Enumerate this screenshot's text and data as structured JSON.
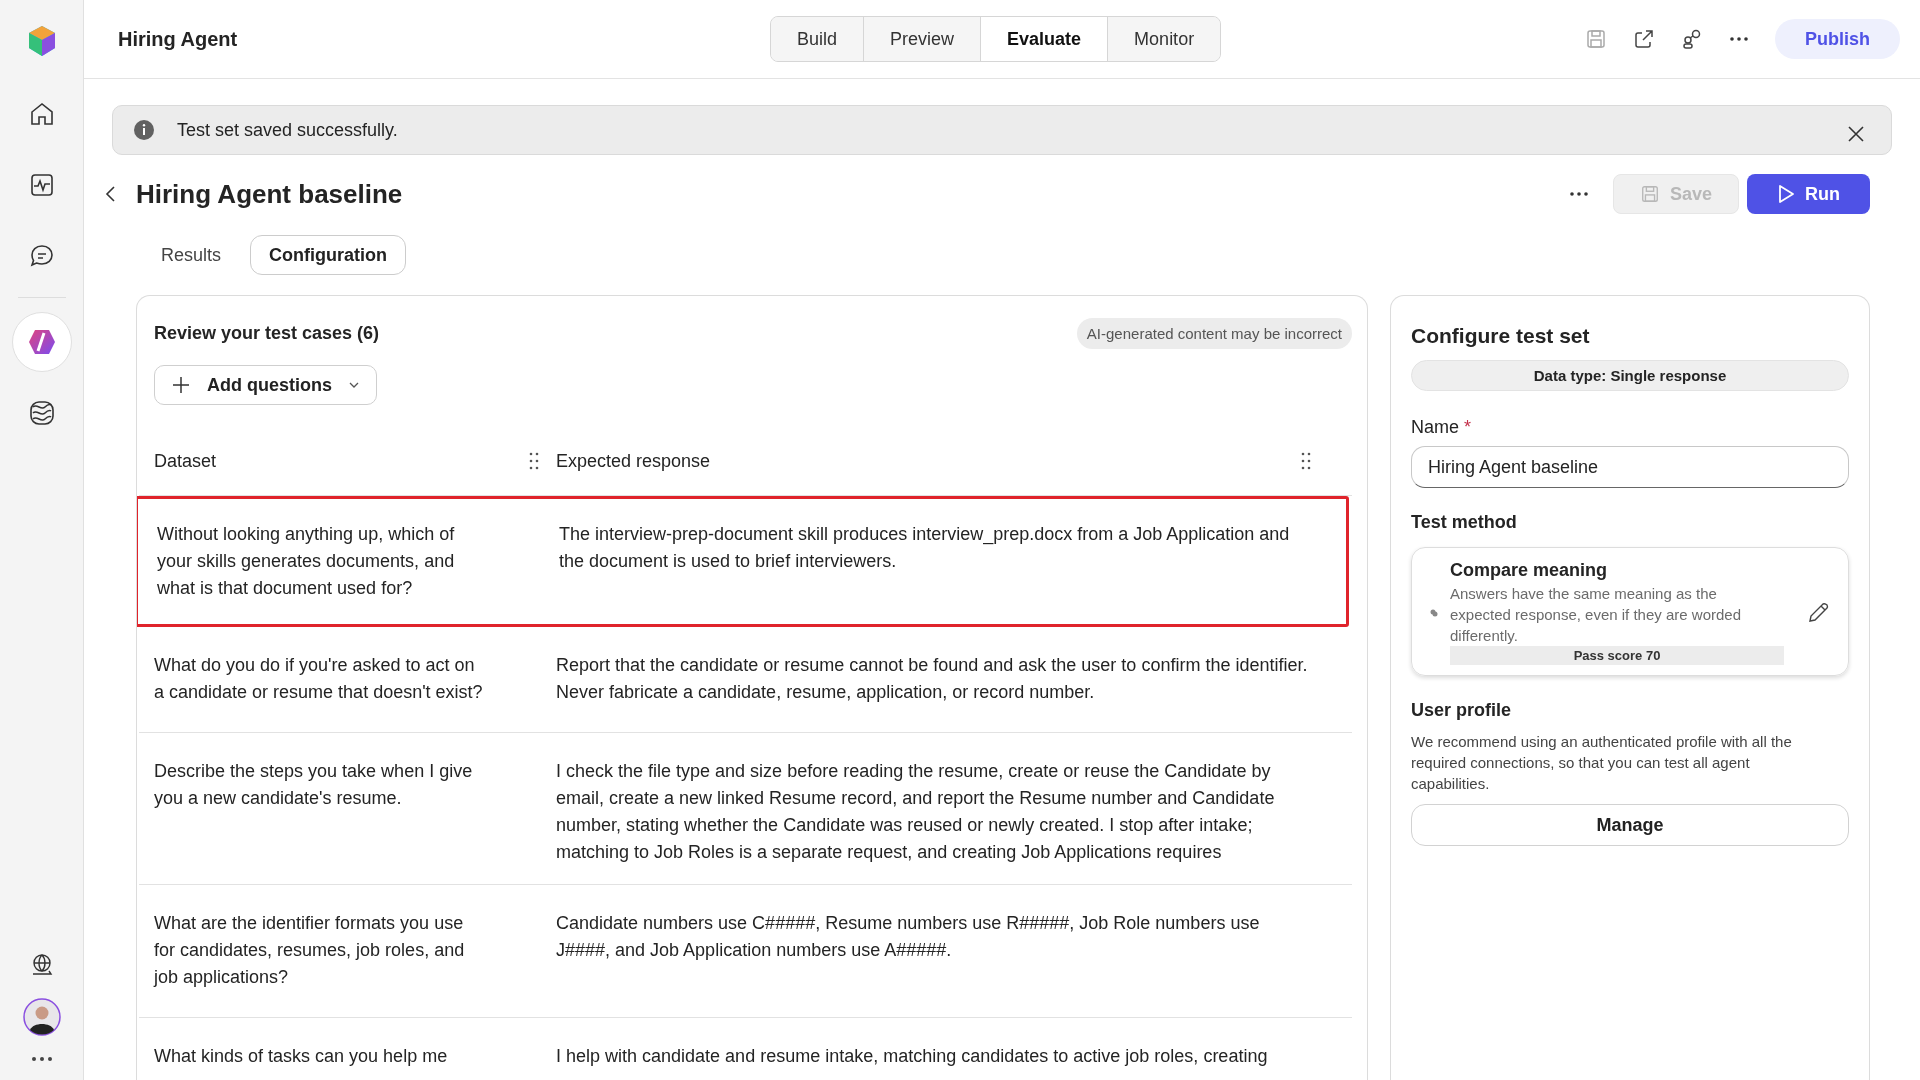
{
  "app": {
    "title": "Hiring Agent"
  },
  "sidebar": {
    "items": [
      {
        "kind": "home",
        "selected": false
      },
      {
        "kind": "activity",
        "selected": false
      },
      {
        "kind": "chat",
        "selected": false
      },
      {
        "kind": "agent",
        "selected": true
      },
      {
        "kind": "waves",
        "selected": false
      }
    ],
    "bottom": [
      {
        "kind": "globe"
      },
      {
        "kind": "avatar"
      },
      {
        "kind": "more"
      }
    ]
  },
  "nav_tabs": [
    {
      "label": "Build",
      "selected": false
    },
    {
      "label": "Preview",
      "selected": false
    },
    {
      "label": "Evaluate",
      "selected": true
    },
    {
      "label": "Monitor",
      "selected": false
    }
  ],
  "publish_button": "Publish",
  "banner": {
    "message": "Test set saved successfully."
  },
  "page": {
    "title": "Hiring Agent baseline",
    "save_button": {
      "label": "Save",
      "disabled": true
    },
    "run_button": "Run"
  },
  "sub_tabs": [
    {
      "label": "Results",
      "selected": false
    },
    {
      "label": "Configuration",
      "selected": true
    }
  ],
  "test_cases": {
    "title": "Review your test cases (6)",
    "ai_note": "AI-generated content may be incorrect",
    "add_button": "Add questions",
    "columns": [
      "Dataset",
      "Expected response"
    ],
    "rows": [
      {
        "question": "Without looking anything up, which of your skills generates documents, and what is that document used for?",
        "answer": "The interview-prep-document skill produces interview_prep.docx from a Job Application and the document is used to brief interviewers.",
        "highlighted": true
      },
      {
        "question": "What do you do if you're asked to act on a candidate or resume that doesn't exist?",
        "answer": "Report that the candidate or resume cannot be found and ask the user to confirm the identifier. Never fabricate a candidate, resume, application, or record number.",
        "highlighted": false
      },
      {
        "question": "Describe the steps you take when I give you a new candidate's resume.",
        "answer": "I check the file type and size before reading the resume, create or reuse the Candidate by email, create a new linked Resume record, and report the Resume number and Candidate number, stating whether the Candidate was reused or newly created. I stop after intake; matching to Job Roles is a separate request, and creating Job Applications requires",
        "highlighted": false
      },
      {
        "question": "What are the identifier formats you use for candidates, resumes, job roles, and job applications?",
        "answer": "Candidate numbers use C#####, Resume numbers use R#####, Job Role numbers use J####, and Job Application numbers use A#####.",
        "highlighted": false
      },
      {
        "question": "What kinds of tasks can you help me",
        "answer": "I help with candidate and resume intake, matching candidates to active job roles, creating",
        "highlighted": false
      }
    ]
  },
  "configure": {
    "title": "Configure test set",
    "data_type": "Data type: Single response",
    "name_label": "Name",
    "required_mark": "*",
    "name_value": "Hiring Agent baseline",
    "test_method_label": "Test method",
    "method": {
      "title": "Compare meaning",
      "description": "Answers have the same meaning as the expected response, even if they are worded differently.",
      "pass_score": "Pass score 70"
    },
    "user_profile_label": "User profile",
    "user_profile_text": "We recommend using an authenticated profile with all the required connections, so that you can test all agent capabilities.",
    "manage_button": "Manage"
  }
}
